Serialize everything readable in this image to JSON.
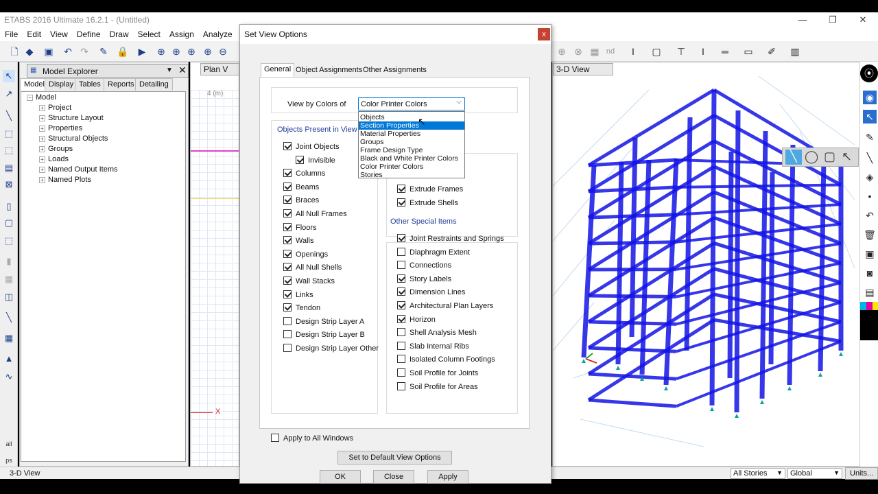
{
  "app": {
    "title": "ETABS 2016 Ultimate 16.2.1 - (Untitled)"
  },
  "window_controls": {
    "minimize": "—",
    "restore": "❐",
    "close": "✕"
  },
  "menu": [
    "File",
    "Edit",
    "View",
    "Define",
    "Draw",
    "Select",
    "Assign",
    "Analyze"
  ],
  "explorer": {
    "title": "Model Explorer",
    "tabs": [
      "Model",
      "Display",
      "Tables",
      "Reports",
      "Detailing"
    ],
    "root": "Model",
    "items": [
      "Project",
      "Structure Layout",
      "Properties",
      "Structural Objects",
      "Groups",
      "Loads",
      "Named Output Items",
      "Named Plots"
    ]
  },
  "plan_view": {
    "tab": "Plan V",
    "dim": "4 (m)",
    "axis": "X"
  },
  "view3d": {
    "tab": "3-D View",
    "structure_color": "#1414e6"
  },
  "status": {
    "text": "3-D View",
    "stories": "All Stories",
    "coord": "Global",
    "units": "Units..."
  },
  "dialog": {
    "title": "Set View Options",
    "close": "x",
    "tabs": [
      "General",
      "Object Assignments",
      "Other Assignments"
    ],
    "view_by_label": "View by Colors of",
    "view_by_value": "Color Printer Colors",
    "dropdown_options": [
      "Objects",
      "Section Properties",
      "Material Properties",
      "Groups",
      "Frame Design Type",
      "Black and White Printer Colors",
      "Color Printer Colors",
      "Stories"
    ],
    "dropdown_highlight": "Section Properties",
    "objects_group_title": "Objects Present in View",
    "objects": [
      {
        "label": "Joint Objects",
        "checked": true
      },
      {
        "label": "Invisible",
        "checked": true
      },
      {
        "label": "Columns",
        "checked": true
      },
      {
        "label": "Beams",
        "checked": true
      },
      {
        "label": "Braces",
        "checked": true
      },
      {
        "label": "All Null Frames",
        "checked": true
      },
      {
        "label": "Floors",
        "checked": true
      },
      {
        "label": "Walls",
        "checked": true
      },
      {
        "label": "Openings",
        "checked": true
      },
      {
        "label": "All Null Shells",
        "checked": true
      },
      {
        "label": "Wall Stacks",
        "checked": true
      },
      {
        "label": "Links",
        "checked": true
      },
      {
        "label": "Tendon",
        "checked": true
      },
      {
        "label": "Design Strip Layer A",
        "checked": false
      },
      {
        "label": "Design Strip Layer B",
        "checked": false
      },
      {
        "label": "Design Strip Layer Other",
        "checked": false
      }
    ],
    "extrude": [
      {
        "label": "Extrude Frames",
        "checked": true
      },
      {
        "label": "Extrude Shells",
        "checked": true
      }
    ],
    "special_group_title": "Other Special Items",
    "special": [
      {
        "label": "Joint Restraints and Springs",
        "checked": true
      },
      {
        "label": "Diaphragm Extent",
        "checked": false
      },
      {
        "label": "Connections",
        "checked": false
      },
      {
        "label": "Story Labels",
        "checked": true
      },
      {
        "label": "Dimension Lines",
        "checked": true
      },
      {
        "label": "Architectural Plan Layers",
        "checked": true
      },
      {
        "label": "Horizon",
        "checked": true
      },
      {
        "label": "Shell Analysis Mesh",
        "checked": false
      },
      {
        "label": "Slab Internal Ribs",
        "checked": false
      },
      {
        "label": "Isolated Column Footings",
        "checked": false
      },
      {
        "label": "Soil Profile for Joints",
        "checked": false
      },
      {
        "label": "Soil Profile for Areas",
        "checked": false
      }
    ],
    "apply_all_label": "Apply to All Windows",
    "apply_all_checked": false,
    "default_button": "Set to Default View Options",
    "ok": "OK",
    "close_button": "Close",
    "apply": "Apply"
  }
}
